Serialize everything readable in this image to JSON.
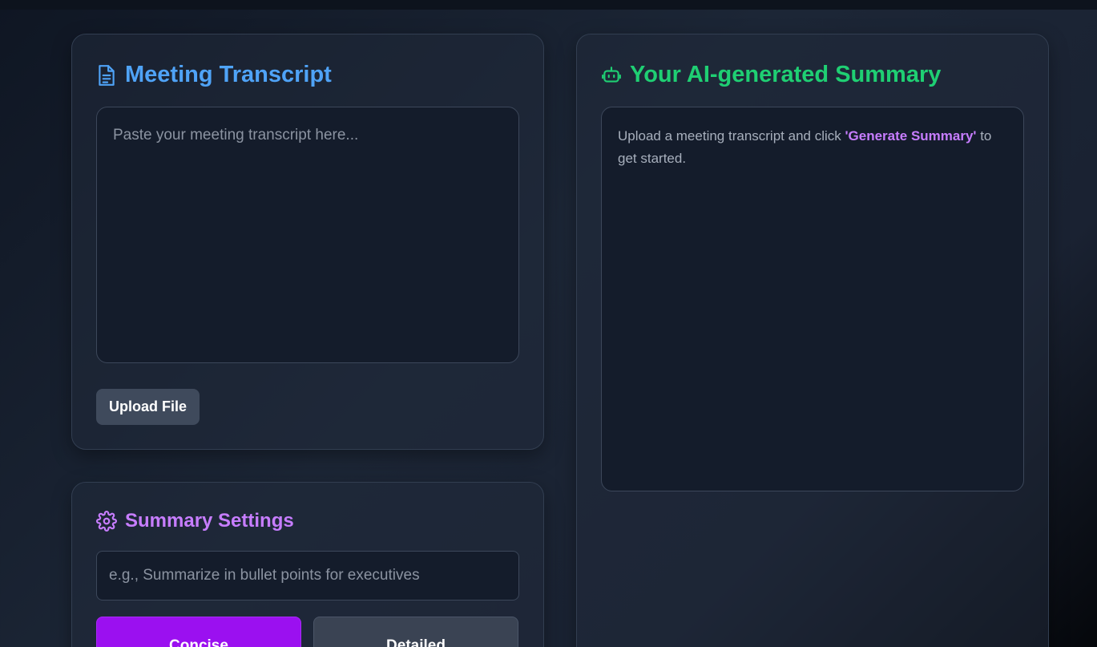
{
  "transcript_panel": {
    "title": "Meeting Transcript",
    "icon": "document-icon",
    "textarea_placeholder": "Paste your meeting transcript here...",
    "textarea_value": "",
    "upload_label": "Upload File",
    "accent_color": "#4fa3f7"
  },
  "summary_panel": {
    "title": "Your AI-generated Summary",
    "icon": "robot-icon",
    "message_before": "Upload a meeting transcript and click ",
    "message_highlight": "'Generate Summary'",
    "message_after": " to get started.",
    "accent_color": "#1fcf73",
    "highlight_color": "#c77dff"
  },
  "settings_panel": {
    "title": "Summary Settings",
    "icon": "gear-icon",
    "prompt_placeholder": "e.g., Summarize in bullet points for executives",
    "prompt_value": "",
    "modes": [
      {
        "label": "Concise",
        "selected": true
      },
      {
        "label": "Detailed",
        "selected": false
      }
    ],
    "accent_color": "#c77dff",
    "selected_color": "#9b10f0"
  }
}
